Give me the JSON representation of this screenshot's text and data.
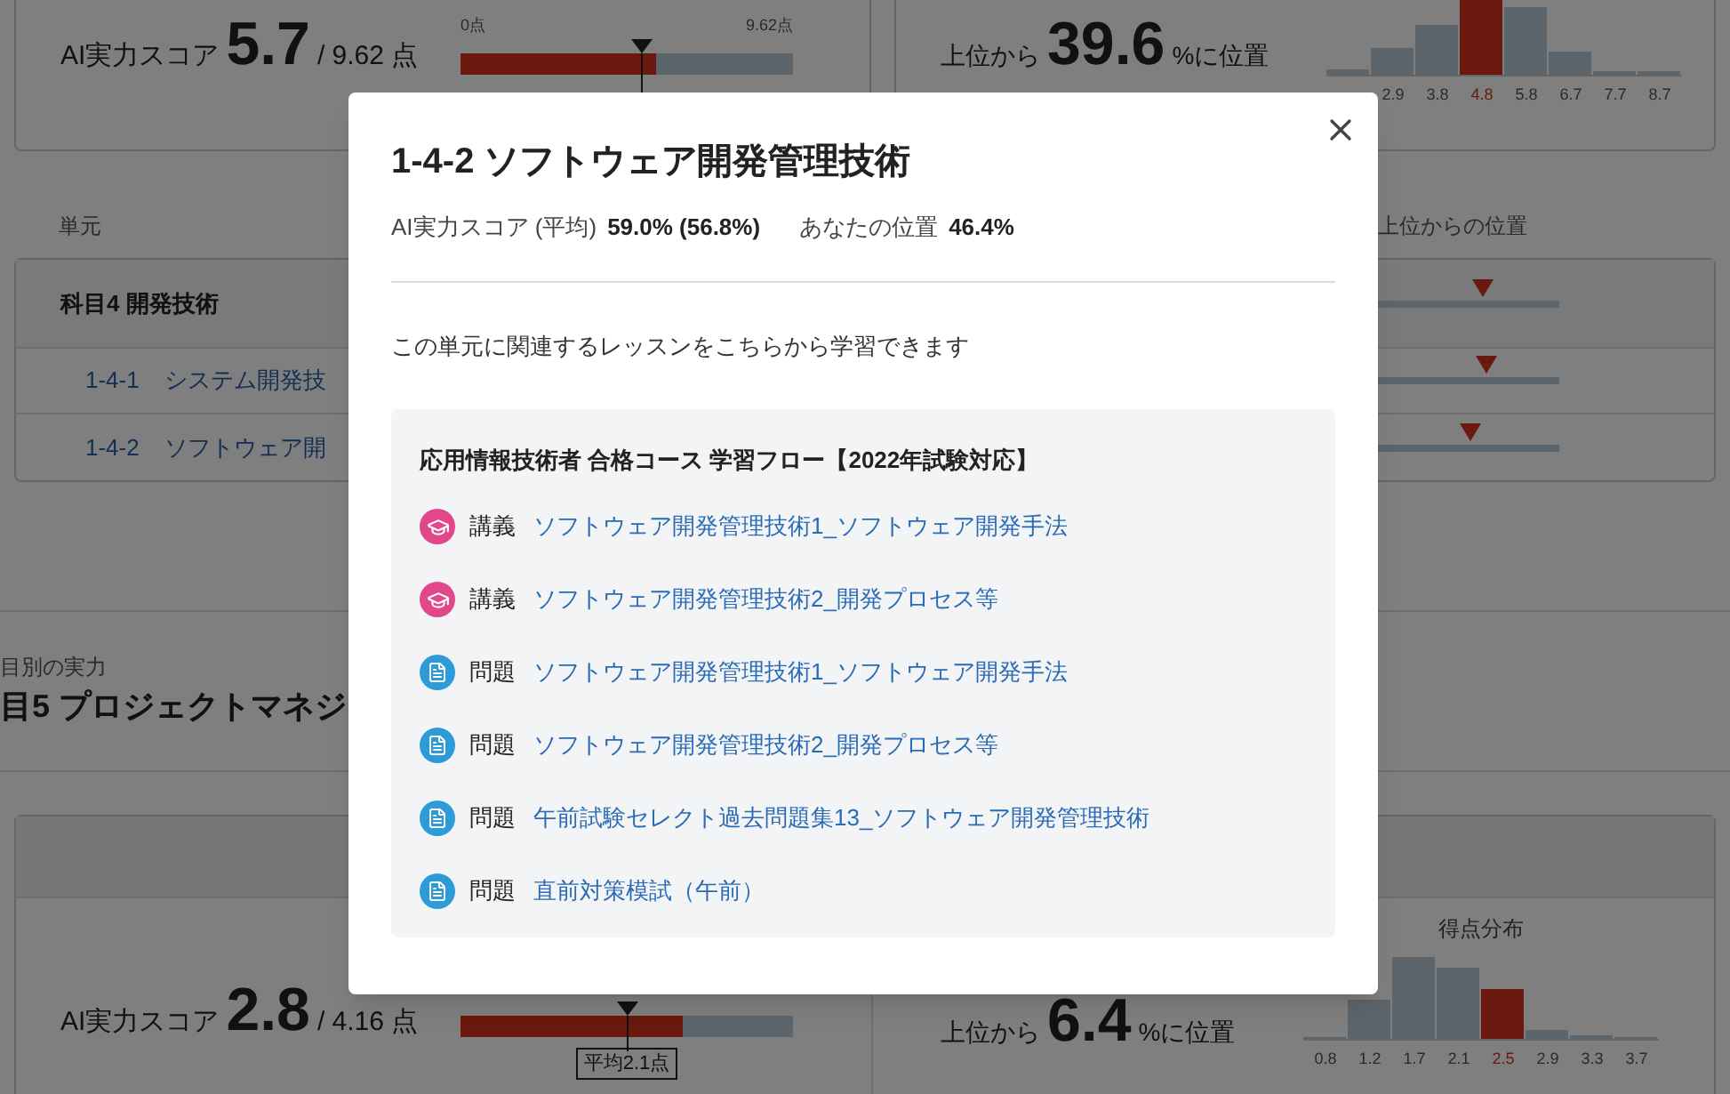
{
  "page": {
    "overall": {
      "score_label": "AI実力スコア",
      "score": "5.7",
      "max": "/ 9.62 点",
      "bar_min": "0点",
      "bar_max": "9.62点",
      "level": 0.59
    },
    "overall_rank": {
      "prefix": "上位から",
      "value": "39.6",
      "suffix": "%に位置",
      "bins": [
        {
          "selected": false
        },
        {
          "label": "2.9",
          "selected": false
        },
        {
          "label": "3.8",
          "selected": false
        },
        {
          "label": "4.8",
          "selected": true
        },
        {
          "label": "5.8",
          "selected": false
        },
        {
          "label": "6.7",
          "selected": false
        },
        {
          "label": "7.7",
          "selected": false
        },
        {
          "label": "8.7",
          "selected": false
        }
      ]
    },
    "unit_table": {
      "column_1": "単元",
      "column_2": "上位からの位置",
      "rows": [
        {
          "kind": "subject",
          "label": "科目4 開発技術",
          "level": 0.785
        },
        {
          "kind": "unit",
          "code": "1-4-1",
          "name": "システム開発技",
          "level": 0.795
        },
        {
          "kind": "unit",
          "code": "1-4-2",
          "name": "ソフトウェア開",
          "level": 0.75
        }
      ]
    },
    "section": {
      "caption": "目別の実力",
      "title": "目5 プロジェクトマネジ"
    },
    "subject5": {
      "score_label": "AI実力スコア",
      "score": "2.8",
      "max": "/ 4.16 点",
      "level": 0.67,
      "average_label": "平均2.1点",
      "rank_prefix": "上位から",
      "rank_value": "6.4",
      "rank_suffix": "%に位置",
      "histogram_title": "得点分布",
      "bins": [
        {
          "label": "0.8",
          "selected": false
        },
        {
          "label": "1.2",
          "selected": false
        },
        {
          "label": "1.7",
          "selected": false
        },
        {
          "label": "2.1",
          "selected": false
        },
        {
          "label": "2.5",
          "selected": true
        },
        {
          "label": "2.9",
          "selected": false
        },
        {
          "label": "3.3",
          "selected": false
        },
        {
          "label": "3.7",
          "selected": false
        }
      ]
    }
  },
  "modal": {
    "title": "1-4-2 ソフトウェア開発管理技術",
    "score_label": "AI実力スコア (平均)",
    "score_value": "59.0% (56.8%)",
    "position_label": "あなたの位置",
    "position_value": "46.4%",
    "description": "この単元に関連するレッスンをこちらから学習できます",
    "course_title": "応用情報技術者 合格コース 学習フロー【2022年試験対応】",
    "lessons": [
      {
        "kind": "lecture",
        "type": "講義",
        "title": "ソフトウェア開発管理技術1_ソフトウェア開発手法"
      },
      {
        "kind": "lecture",
        "type": "講義",
        "title": "ソフトウェア開発管理技術2_開発プロセス等"
      },
      {
        "kind": "problem",
        "type": "問題",
        "title": "ソフトウェア開発管理技術1_ソフトウェア開発手法"
      },
      {
        "kind": "problem",
        "type": "問題",
        "title": "ソフトウェア開発管理技術2_開発プロセス等"
      },
      {
        "kind": "problem",
        "type": "問題",
        "title": "午前試験セレクト過去問題集13_ソフトウェア開発管理技術"
      },
      {
        "kind": "problem",
        "type": "問題",
        "title": "直前対策模試（午前）"
      }
    ]
  }
}
